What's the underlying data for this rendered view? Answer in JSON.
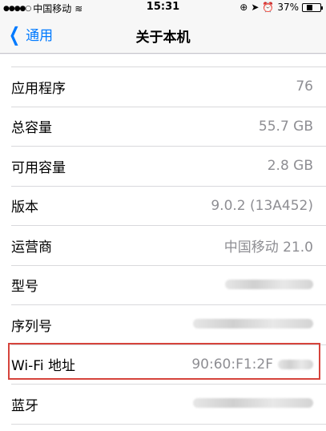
{
  "status_bar": {
    "signal_dots": "●●●●○",
    "carrier": "中国移动",
    "wifi": "≋",
    "time": "15:31",
    "lock_icon": "⊕",
    "location_icon": "➤",
    "alarm_icon": "⏰",
    "battery_percent": "37%",
    "battery_level": 0.37
  },
  "nav": {
    "back_label": "通用",
    "title": "关于本机"
  },
  "rows": [
    {
      "label": "应用程序",
      "value": "76"
    },
    {
      "label": "总容量",
      "value": "55.7 GB"
    },
    {
      "label": "可用容量",
      "value": "2.8 GB"
    },
    {
      "label": "版本",
      "value": "9.0.2 (13A452)"
    },
    {
      "label": "运营商",
      "value": "中国移动 21.0"
    },
    {
      "label": "型号",
      "value": ""
    },
    {
      "label": "序列号",
      "value": ""
    },
    {
      "label": "Wi-Fi 地址",
      "value": "90:60:F1:2F"
    },
    {
      "label": "蓝牙",
      "value": ""
    }
  ],
  "colors": {
    "accent": "#007aff",
    "highlight_border": "#d6443c",
    "value_text": "#8e8e93"
  }
}
